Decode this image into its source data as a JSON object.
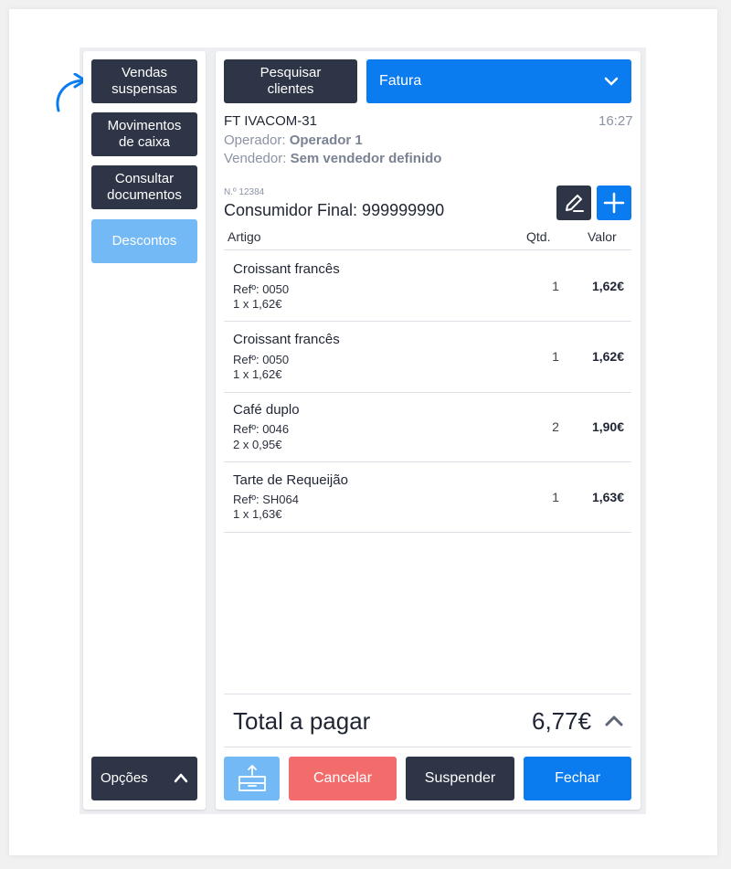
{
  "sidebar": {
    "buttons": [
      "Vendas\nsuspensas",
      "Movimentos\nde caixa",
      "Consultar\ndocumentos",
      "Descontos"
    ],
    "options_label": "Opções"
  },
  "header": {
    "search_clients_label": "Pesquisar\nclientes",
    "doc_type": "Fatura"
  },
  "document": {
    "code": "FT IVACOM-31",
    "time": "16:27",
    "operator_label": "Operador:",
    "operator": "Operador 1",
    "seller_label": "Vendedor:",
    "seller": "Sem vendedor definido",
    "number": "N.º 12384",
    "customer": "Consumidor Final: 999999990"
  },
  "table": {
    "headers": [
      "Artigo",
      "Qtd.",
      "Valor"
    ],
    "rows": [
      {
        "name": "Croissant francês",
        "ref": "Refº: 0050",
        "calc": "1 x 1,62€",
        "qty": "1",
        "value": "1,62€"
      },
      {
        "name": "Croissant francês",
        "ref": "Refº: 0050",
        "calc": "1 x 1,62€",
        "qty": "1",
        "value": "1,62€"
      },
      {
        "name": "Café duplo",
        "ref": "Refº: 0046",
        "calc": "2 x 0,95€",
        "qty": "2",
        "value": "1,90€"
      },
      {
        "name": "Tarte de Requeijão",
        "ref": "Refº: SH064",
        "calc": "1 x 1,63€",
        "qty": "1",
        "value": "1,63€"
      }
    ]
  },
  "total": {
    "label": "Total a pagar",
    "value": "6,77€"
  },
  "footer": {
    "cancel_label": "Cancelar",
    "suspend_label": "Suspender",
    "close_label": "Fechar"
  },
  "colors": {
    "dark": "#2d3546",
    "blue": "#0a7cf0",
    "light_blue": "#73b9f5",
    "red": "#f36c6c"
  },
  "icons": [
    "curved-arrow-icon",
    "chevron-up-icon",
    "chevron-down-icon",
    "pencil-icon",
    "plus-icon",
    "cash-drawer-icon"
  ]
}
